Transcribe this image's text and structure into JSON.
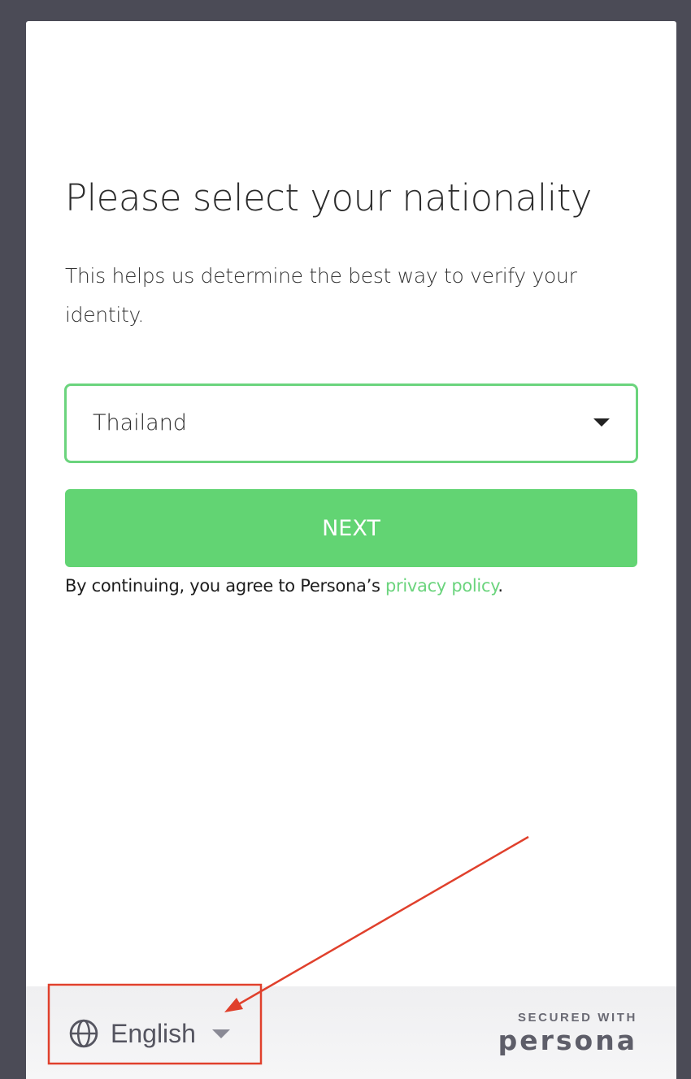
{
  "page": {
    "title": "Please select your nationality",
    "subtitle": "This helps us determine the best way to verify your identity."
  },
  "nationality_select": {
    "selected_value": "Thailand"
  },
  "next_button": {
    "label": "NEXT"
  },
  "consent": {
    "text": "By continuing, you agree to Persona’s ",
    "link_text": "privacy policy",
    "suffix": "."
  },
  "footer": {
    "language": "English",
    "secured_label": "SECURED WITH",
    "brand": "persona"
  },
  "icons": {
    "language": "globe-icon",
    "select_caret": "caret-down-icon",
    "language_caret": "caret-down-icon"
  },
  "colors": {
    "accent": "#62d473",
    "link": "#6bd47d",
    "annotation": "#e0402c",
    "backdrop": "#4b4b56"
  }
}
